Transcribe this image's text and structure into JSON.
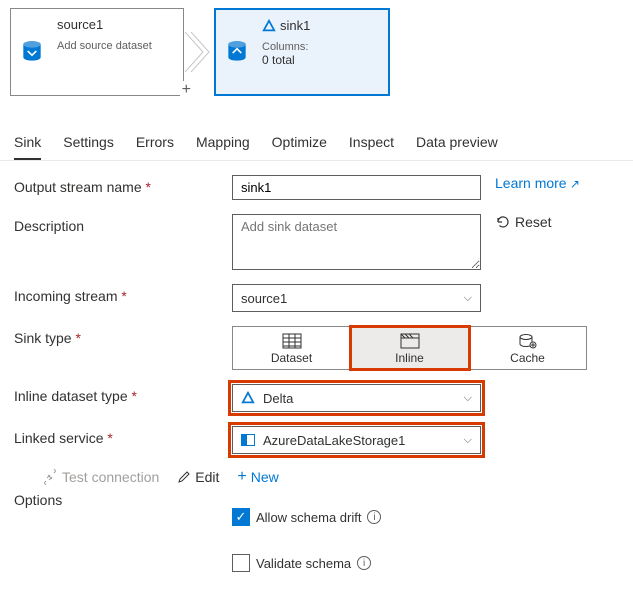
{
  "canvas": {
    "source": {
      "title": "source1",
      "subtitle": "Add source dataset"
    },
    "sink": {
      "title": "sink1",
      "col_label": "Columns:",
      "col_value": "0 total"
    }
  },
  "tabs": [
    "Sink",
    "Settings",
    "Errors",
    "Mapping",
    "Optimize",
    "Inspect",
    "Data preview"
  ],
  "active_tab": 0,
  "form": {
    "output_stream_label": "Output stream name",
    "output_stream_value": "sink1",
    "learn_more": "Learn more",
    "description_label": "Description",
    "description_placeholder": "Add sink dataset",
    "reset_label": "Reset",
    "incoming_label": "Incoming stream",
    "incoming_value": "source1",
    "sink_type_label": "Sink type",
    "sink_types": [
      "Dataset",
      "Inline",
      "Cache"
    ],
    "sink_type_selected": 1,
    "inline_type_label": "Inline dataset type",
    "inline_type_value": "Delta",
    "linked_service_label": "Linked service",
    "linked_service_value": "AzureDataLakeStorage1",
    "test_connection": "Test connection",
    "edit_label": "Edit",
    "new_label": "New",
    "options_label": "Options",
    "allow_drift": "Allow schema drift",
    "validate_schema": "Validate schema"
  }
}
